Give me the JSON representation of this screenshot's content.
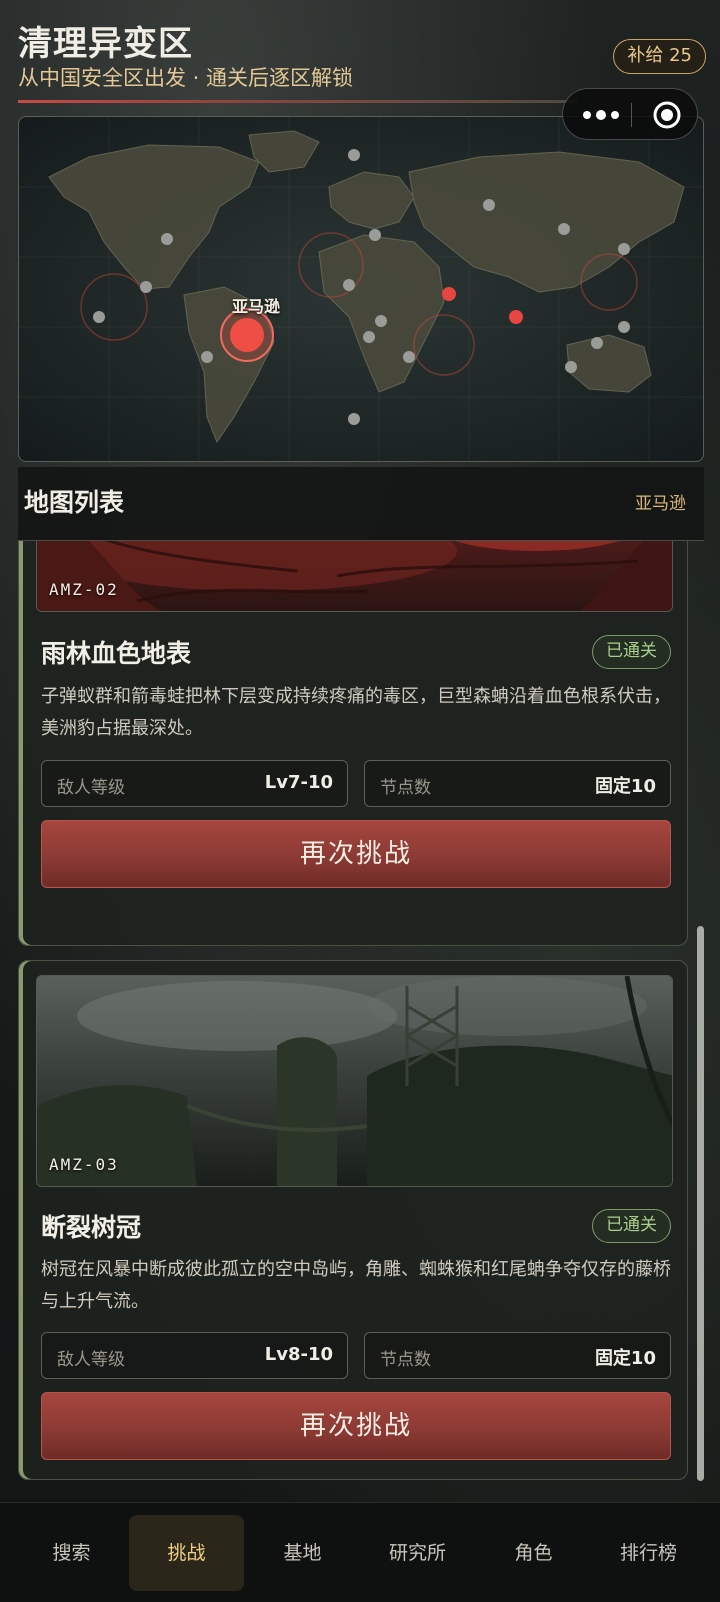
{
  "header": {
    "title": "清理异变区",
    "subtitle": "从中国安全区出发 · 通关后逐区解锁",
    "supply_label": "补给 25"
  },
  "map": {
    "selected_label": "亚马逊",
    "accent_color": "#e5463f"
  },
  "section": {
    "title": "地图列表",
    "region": "亚马逊"
  },
  "cards": [
    {
      "code": "AMZ-02",
      "name": "雨林血色地表",
      "status": "已通关",
      "description": "子弹蚁群和箭毒蛙把林下层变成持续疼痛的毒区，巨型森蚺沿着血色根系伏击，美洲豹占据最深处。",
      "enemy_level_label": "敌人等级",
      "enemy_level_value": "Lv7-10",
      "nodes_label": "节点数",
      "nodes_value": "固定10",
      "button_label": "再次挑战"
    },
    {
      "code": "AMZ-03",
      "name": "断裂树冠",
      "status": "已通关",
      "description": "树冠在风暴中断成彼此孤立的空中岛屿，角雕、蜘蛛猴和红尾蚺争夺仅存的藤桥与上升气流。",
      "enemy_level_label": "敌人等级",
      "enemy_level_value": "Lv8-10",
      "nodes_label": "节点数",
      "nodes_value": "固定10",
      "button_label": "再次挑战"
    }
  ],
  "nav": {
    "items": [
      "搜索",
      "挑战",
      "基地",
      "研究所",
      "角色",
      "排行榜"
    ],
    "active": "挑战"
  }
}
